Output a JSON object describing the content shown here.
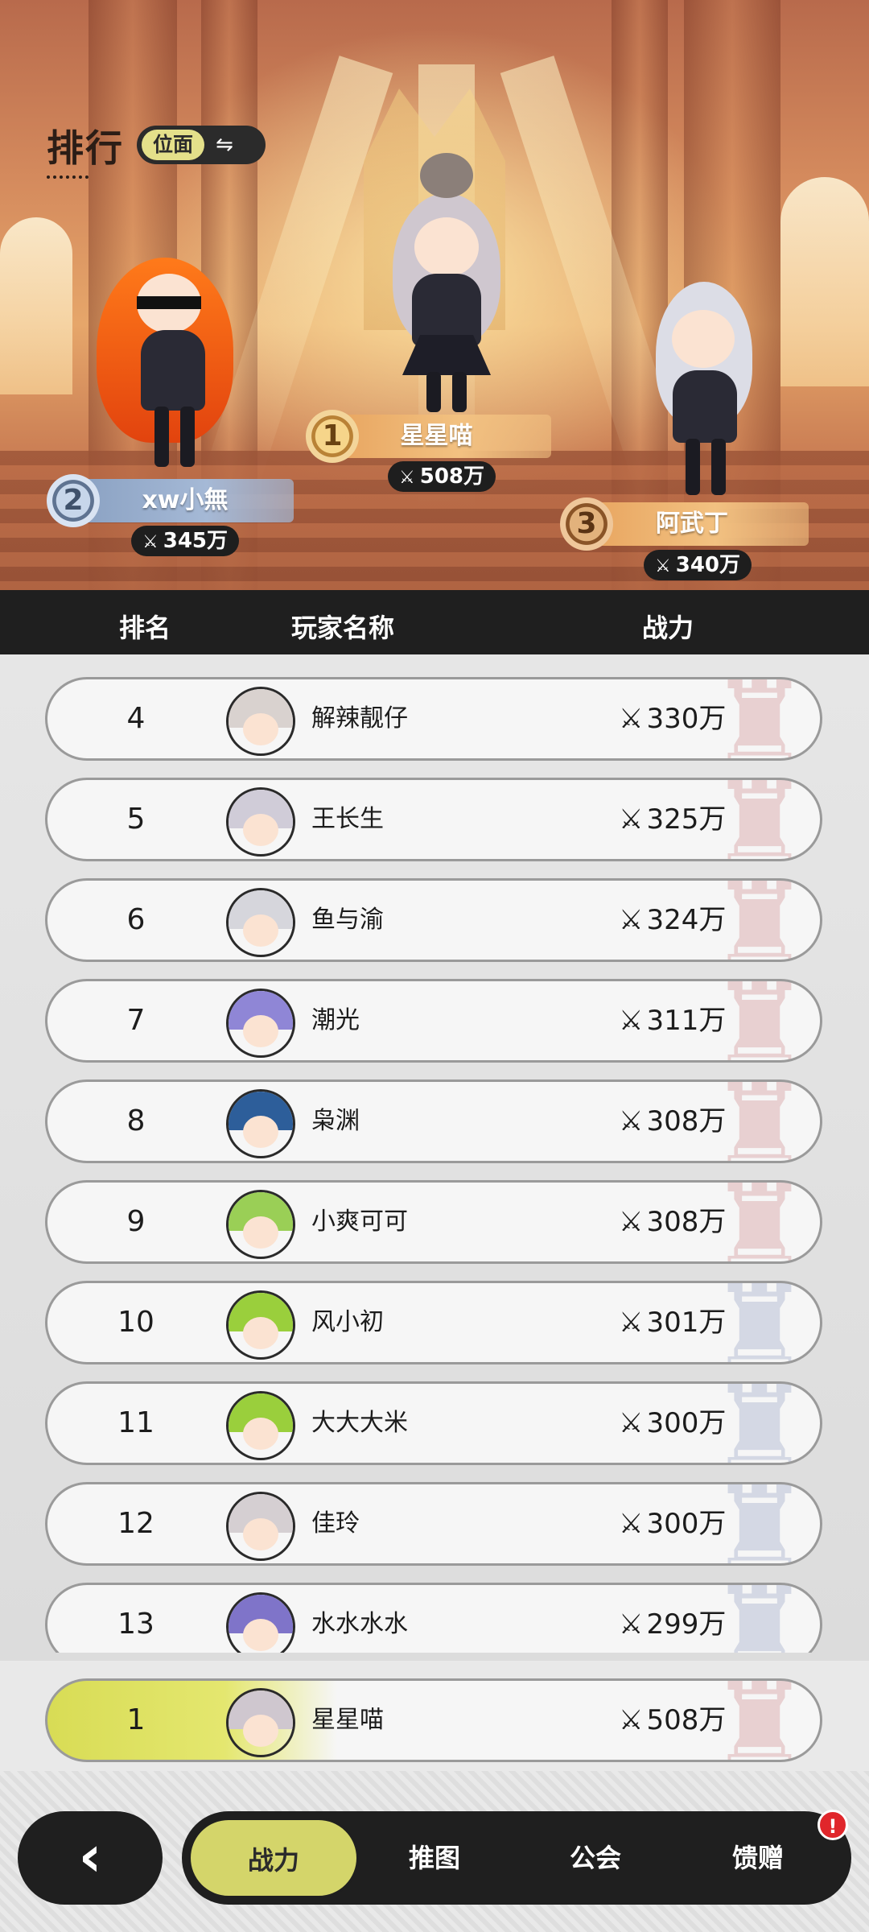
{
  "header": {
    "title": "排行",
    "scope_label": "位面",
    "swap_icon": "swap-arrows-icon"
  },
  "podium": [
    {
      "place": "1",
      "name": "星星喵",
      "power": "508万"
    },
    {
      "place": "2",
      "name": "xw小無",
      "power": "345万"
    },
    {
      "place": "3",
      "name": "阿武丁",
      "power": "340万"
    }
  ],
  "columns": {
    "rank": "排名",
    "player": "玩家名称",
    "power": "战力"
  },
  "rows": [
    {
      "rank": "4",
      "name": "解辣靓仔",
      "power": "330万"
    },
    {
      "rank": "5",
      "name": "王长生",
      "power": "325万"
    },
    {
      "rank": "6",
      "name": "鱼与渝",
      "power": "324万"
    },
    {
      "rank": "7",
      "name": "潮光",
      "power": "311万"
    },
    {
      "rank": "8",
      "name": "枭渊",
      "power": "308万"
    },
    {
      "rank": "9",
      "name": "小爽可可",
      "power": "308万"
    },
    {
      "rank": "10",
      "name": "风小初",
      "power": "301万"
    },
    {
      "rank": "11",
      "name": "大大大米",
      "power": "300万"
    },
    {
      "rank": "12",
      "name": "佳玲",
      "power": "300万"
    },
    {
      "rank": "13",
      "name": "水水水水",
      "power": "299万"
    }
  ],
  "my_rank": {
    "rank": "1",
    "name": "星星喵",
    "power": "508万"
  },
  "nav": {
    "back_icon": "back-arrow-icon",
    "tabs": [
      "战力",
      "推图",
      "公会",
      "馈赠"
    ],
    "alert": "!"
  },
  "colors": {
    "accent": "#d4d56a",
    "dark": "#1f1f1f",
    "gold_banner": "#e7a25c",
    "blue_banner": "#8aa1c2"
  }
}
